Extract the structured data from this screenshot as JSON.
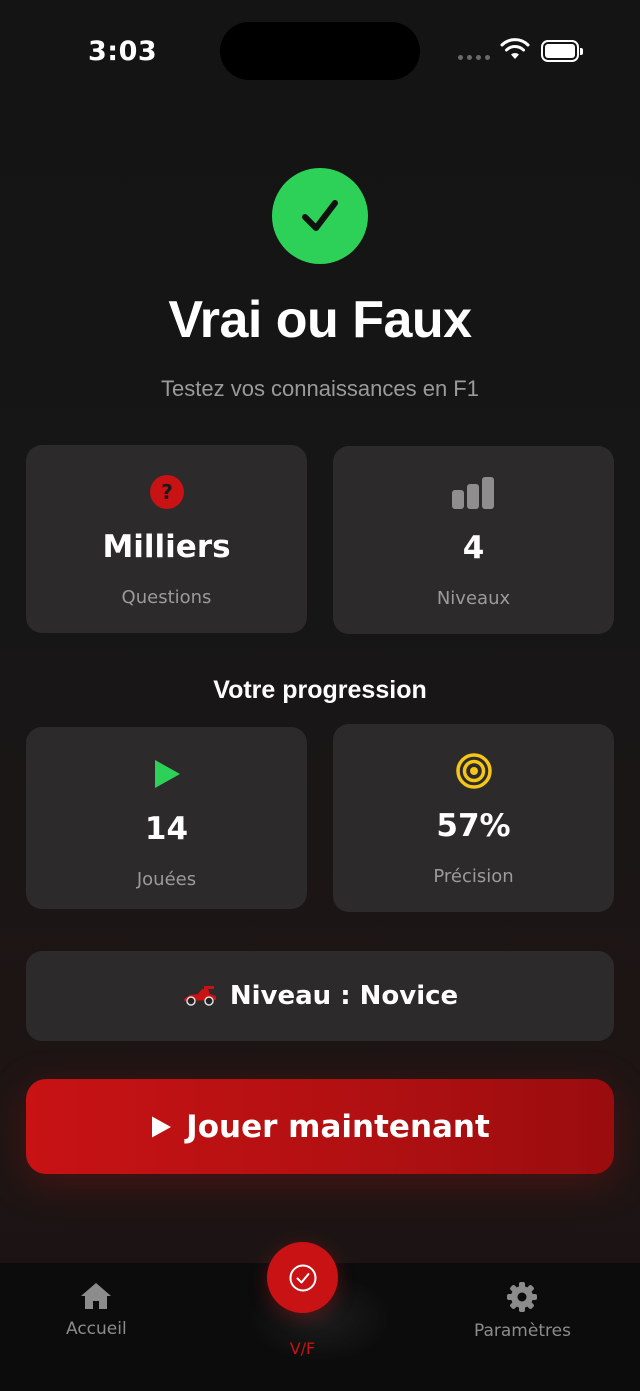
{
  "status_bar": {
    "time": "3:03"
  },
  "header": {
    "title": "Vrai ou Faux",
    "subtitle": "Testez vos connaissances en F1"
  },
  "info_cards": [
    {
      "value": "Milliers",
      "label": "Questions",
      "icon": "question-circle-icon"
    },
    {
      "value": "4",
      "label": "Niveaux",
      "icon": "bar-chart-icon"
    }
  ],
  "progress": {
    "title": "Votre progression",
    "cards": [
      {
        "value": "14",
        "label": "Jouées",
        "icon": "play-icon"
      },
      {
        "value": "57%",
        "label": "Précision",
        "icon": "target-icon"
      }
    ]
  },
  "level": {
    "text": "Niveau : Novice",
    "icon": "race-car-icon"
  },
  "play_button": {
    "label": "Jouer maintenant"
  },
  "tab_bar": {
    "home_label": "Accueil",
    "center_label": "V/F",
    "settings_label": "Paramètres"
  },
  "colors": {
    "accent_red": "#c81214",
    "success_green": "#2ed158",
    "target_yellow": "#f5c518",
    "card_bg": "#2c2a2a"
  }
}
